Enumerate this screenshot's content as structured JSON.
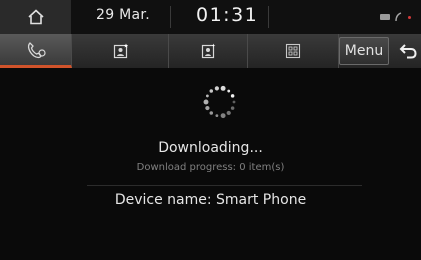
{
  "status_bar": {
    "home_icon": "home-icon",
    "date": "29 Mar.",
    "time": "01:31",
    "status_icons": [
      "battery-icon",
      "signal-icon"
    ]
  },
  "toolbar": {
    "tabs": [
      {
        "name": "call-history",
        "icon": "phone-handset-icon",
        "active": true
      },
      {
        "name": "contacts-download",
        "icon": "contact-star-icon",
        "active": false
      },
      {
        "name": "favorites",
        "icon": "contact-card-icon",
        "active": false
      },
      {
        "name": "dial-pad",
        "icon": "keypad-icon",
        "active": false
      }
    ],
    "menu_label": "Menu",
    "back_icon": "back-arrow-icon"
  },
  "main": {
    "title": "Downloading...",
    "progress": "Download progress: 0 item(s)",
    "device_label": "Device name: Smart Phone"
  },
  "colors": {
    "accent": "#d0532b",
    "background": "#0a0a0a",
    "text": "#e6e6e6",
    "muted_text": "#808080"
  }
}
